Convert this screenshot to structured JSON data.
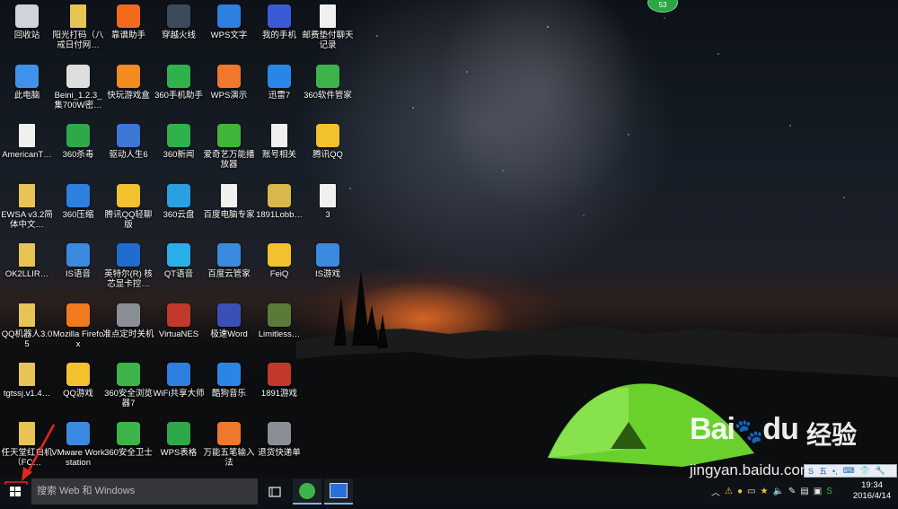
{
  "desktop": {
    "icons": [
      {
        "label": "回收站",
        "icon": "recycle-bin-icon",
        "color": "#cfd4da"
      },
      {
        "label": "阳光打码（八戒日付网…",
        "icon": "folder-icon",
        "color": "#e8c457"
      },
      {
        "label": "靠谱助手",
        "icon": "kaopu-assistant-icon",
        "color": "#f26a1b"
      },
      {
        "label": "穿越火线",
        "icon": "crossfire-icon",
        "color": "#3c4a5a"
      },
      {
        "label": "WPS文字",
        "icon": "wps-writer-icon",
        "color": "#2d7fe0"
      },
      {
        "label": "我的手机",
        "icon": "my-phone-icon",
        "color": "#3a5bd8"
      },
      {
        "label": "邮费垫付聊天记录",
        "icon": "document-icon",
        "color": "#f0f0f0"
      },
      {
        "label": "此电脑",
        "icon": "this-pc-icon",
        "color": "#3f92ea"
      },
      {
        "label": "Beini_1.2.3_集700W密…",
        "icon": "disc-image-icon",
        "color": "#dedede"
      },
      {
        "label": "快玩游戏盒",
        "icon": "kuaiwan-game-box-icon",
        "color": "#f58a1f"
      },
      {
        "label": "360手机助手",
        "icon": "360-phone-assistant-icon",
        "color": "#2fb24c"
      },
      {
        "label": "WPS演示",
        "icon": "wps-presentation-icon",
        "color": "#f0782a"
      },
      {
        "label": "迅雷7",
        "icon": "xunlei-icon",
        "color": "#2a86e6"
      },
      {
        "label": "360软件管家",
        "icon": "360-software-manager-icon",
        "color": "#3cb44a"
      },
      {
        "label": "AmericanT…",
        "icon": "file-icon",
        "color": "#f0f0f0"
      },
      {
        "label": "360杀毒",
        "icon": "360-antivirus-icon",
        "color": "#2fa84a"
      },
      {
        "label": "驱动人生6",
        "icon": "driver-life-icon",
        "color": "#3b78d6"
      },
      {
        "label": "360新闻",
        "icon": "360-news-icon",
        "color": "#2fb24c"
      },
      {
        "label": "爱奇艺万能播放器",
        "icon": "iqiyi-player-icon",
        "color": "#41b43a"
      },
      {
        "label": "账号相关",
        "icon": "document-icon",
        "color": "#f0f0f0"
      },
      {
        "label": "腾讯QQ",
        "icon": "qq-icon",
        "color": "#f2c12e"
      },
      {
        "label": "EWSA v3.2简体中文…",
        "icon": "folder-icon",
        "color": "#e8c457"
      },
      {
        "label": "360压缩",
        "icon": "360-zip-icon",
        "color": "#2d7fe0"
      },
      {
        "label": "腾讯QQ轻聊版",
        "icon": "qq-lite-icon",
        "color": "#f2c12e"
      },
      {
        "label": "360云盘",
        "icon": "360-cloud-icon",
        "color": "#2aa0e0"
      },
      {
        "label": "百度电脑专家",
        "icon": "document-icon",
        "color": "#f0f0f0"
      },
      {
        "label": "1891Lobb…",
        "icon": "game-lobby-icon",
        "color": "#d8b84a"
      },
      {
        "label": "3",
        "icon": "document-icon",
        "color": "#f0f0f0"
      },
      {
        "label": "OK2LLIR…",
        "icon": "folder-icon",
        "color": "#e8c457"
      },
      {
        "label": "IS语音",
        "icon": "is-voice-icon",
        "color": "#3a8be0"
      },
      {
        "label": "英特尔(R) 核芯显卡控…",
        "icon": "intel-graphics-icon",
        "color": "#1e6ccf"
      },
      {
        "label": "QT语音",
        "icon": "qt-voice-icon",
        "color": "#2ab0e8"
      },
      {
        "label": "百度云管家",
        "icon": "baidu-cloud-icon",
        "color": "#3a8be0"
      },
      {
        "label": "FeiQ",
        "icon": "feiq-icon",
        "color": "#f2c12e"
      },
      {
        "label": "IS游戏",
        "icon": "is-game-icon",
        "color": "#3a8be0"
      },
      {
        "label": "QQ机器人3.05",
        "icon": "folder-icon",
        "color": "#e8c457"
      },
      {
        "label": "Mozilla Firefox",
        "icon": "firefox-icon",
        "color": "#f07a1f"
      },
      {
        "label": "准点定时关机",
        "icon": "shutdown-timer-icon",
        "color": "#8a8f96"
      },
      {
        "label": "VirtuaNES",
        "icon": "virtuanes-icon",
        "color": "#c0392b"
      },
      {
        "label": "极速Word",
        "icon": "word-icon",
        "color": "#3b4fb8"
      },
      {
        "label": "Limitless…",
        "icon": "limitless-icon",
        "color": "#5a7a3a"
      },
      {
        "label": "tgtssj.v1.4…",
        "icon": "folder-icon",
        "color": "#e8c457"
      },
      {
        "label": "QQ游戏",
        "icon": "qq-game-icon",
        "color": "#f2c12e"
      },
      {
        "label": "360安全浏览器7",
        "icon": "360-browser-icon",
        "color": "#3cb44a"
      },
      {
        "label": "WiFi共享大师",
        "icon": "wifi-share-icon",
        "color": "#2d7fe0"
      },
      {
        "label": "酷狗音乐",
        "icon": "kugou-music-icon",
        "color": "#2a86e6"
      },
      {
        "label": "1891游戏",
        "icon": "game-icon",
        "color": "#c0392b"
      },
      {
        "label": "任天堂红白机（FC…",
        "icon": "folder-icon",
        "color": "#e8c457"
      },
      {
        "label": "VMware Workstation",
        "icon": "vmware-icon",
        "color": "#3a8be0"
      },
      {
        "label": "360安全卫士",
        "icon": "360-security-icon",
        "color": "#3cb44a"
      },
      {
        "label": "WPS表格",
        "icon": "wps-spreadsheet-icon",
        "color": "#2fa84a"
      },
      {
        "label": "万能五笔输入法",
        "icon": "wubi-ime-icon",
        "color": "#f0782a"
      },
      {
        "label": "退货快递单",
        "icon": "keyboard-icon",
        "color": "#8a8f96"
      }
    ],
    "notification_badge": "53"
  },
  "watermark": {
    "brand": "Bai",
    "brand_tail": "du",
    "jingyan": "经验",
    "url": "jingyan.baidu.com"
  },
  "ime_bar": {
    "items": [
      "S",
      "五",
      "•,",
      "⌨",
      "👕",
      "🔧"
    ]
  },
  "taskbar": {
    "search_placeholder": "搜索 Web 和 Windows",
    "pinned": [
      {
        "icon": "task-view-icon"
      },
      {
        "icon": "360-browser-icon",
        "color": "#3cb44a"
      },
      {
        "icon": "monitor-app-icon",
        "color": "#2a6fd6"
      }
    ],
    "tray_icons": [
      "chevron-up-icon",
      "warning-icon",
      "qq-icon",
      "battery-icon",
      "star-icon",
      "volume-icon",
      "pen-icon",
      "network-icon",
      "notification-icon",
      "sogou-icon"
    ],
    "time": "19:34",
    "date": "2016/4/14"
  }
}
